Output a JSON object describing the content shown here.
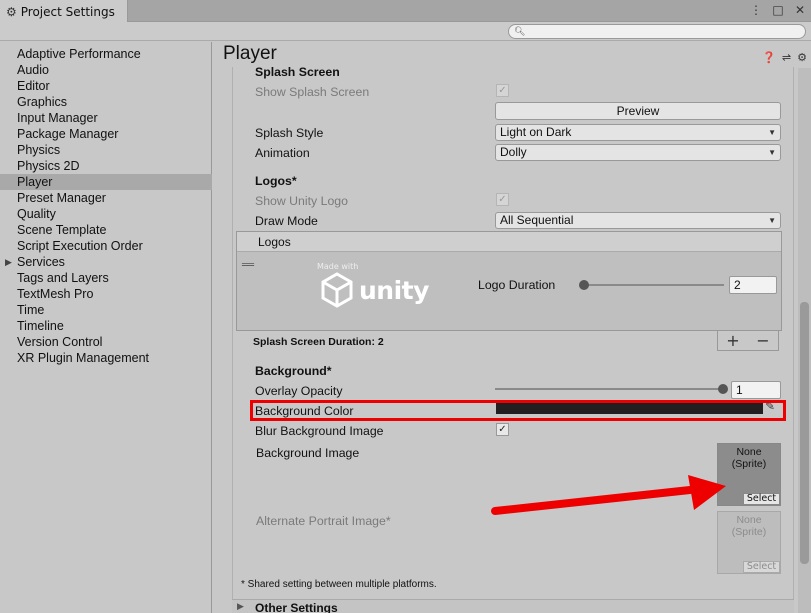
{
  "window": {
    "tab_title": "Project Settings",
    "tab_icon": "gear-icon",
    "controls": [
      "⋮",
      "□",
      "✕"
    ]
  },
  "search": {
    "placeholder": "",
    "icon": "search-icon"
  },
  "sidebar": {
    "items": [
      {
        "label": "Adaptive Performance"
      },
      {
        "label": "Audio"
      },
      {
        "label": "Editor"
      },
      {
        "label": "Graphics"
      },
      {
        "label": "Input Manager"
      },
      {
        "label": "Package Manager"
      },
      {
        "label": "Physics"
      },
      {
        "label": "Physics 2D"
      },
      {
        "label": "Player",
        "selected": true
      },
      {
        "label": "Preset Manager"
      },
      {
        "label": "Quality"
      },
      {
        "label": "Scene Template"
      },
      {
        "label": "Script Execution Order"
      },
      {
        "label": "Services",
        "expandable": true
      },
      {
        "label": "Tags and Layers"
      },
      {
        "label": "TextMesh Pro"
      },
      {
        "label": "Time"
      },
      {
        "label": "Timeline"
      },
      {
        "label": "Version Control"
      },
      {
        "label": "XR Plugin Management"
      }
    ]
  },
  "main": {
    "title": "Player",
    "header_icons": [
      "help-icon",
      "preset-icon",
      "settings-icon"
    ],
    "splash": {
      "section": "Splash Screen",
      "show_splash_label": "Show Splash Screen",
      "show_splash_checked": true,
      "preview_button": "Preview",
      "style_label": "Splash Style",
      "style_value": "Light on Dark",
      "animation_label": "Animation",
      "animation_value": "Dolly"
    },
    "logos": {
      "section": "Logos*",
      "show_unity_logo_label": "Show Unity Logo",
      "show_unity_logo_checked": true,
      "draw_mode_label": "Draw Mode",
      "draw_mode_value": "All Sequential",
      "list_header": "Logos",
      "logo_made_with": "Made with",
      "logo_word": "unity",
      "logo_duration_label": "Logo Duration",
      "logo_duration_value": "2",
      "logo_duration_fraction": 0.0,
      "add_symbol": "+",
      "remove_symbol": "−",
      "splash_duration": "Splash Screen Duration: 2"
    },
    "background": {
      "section": "Background*",
      "overlay_label": "Overlay Opacity",
      "overlay_value": "1",
      "overlay_fraction": 1.0,
      "color_label": "Background Color",
      "color_value": "#231f20",
      "blur_label": "Blur Background Image",
      "blur_checked": true,
      "image_label": "Background Image",
      "image_none": "None",
      "image_type": "(Sprite)",
      "image_select": "Select",
      "alt_label": "Alternate Portrait Image*",
      "alt_none": "None",
      "alt_type": "(Sprite)",
      "alt_select": "Select",
      "shared_note": "* Shared setting between multiple platforms."
    },
    "other_settings": "Other Settings"
  },
  "annotations": {
    "highlight_color": "#ee0000",
    "arrow_color": "#ee0000"
  }
}
